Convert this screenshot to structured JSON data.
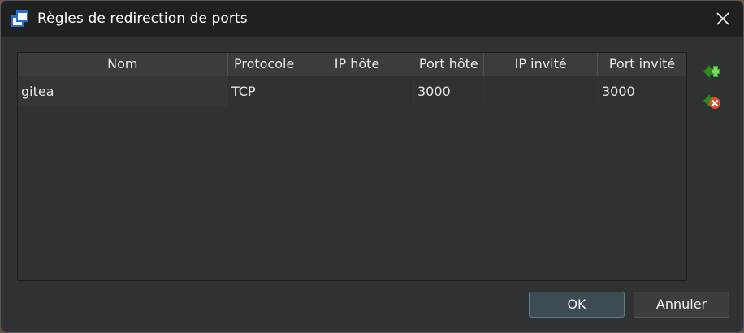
{
  "window": {
    "title": "Règles de redirection de ports",
    "icon": "app-window-icon",
    "close_icon": "close-icon"
  },
  "table": {
    "columns": [
      "Nom",
      "Protocole",
      "IP hôte",
      "Port hôte",
      "IP invité",
      "Port invité"
    ],
    "rows": [
      [
        "gitea",
        "TCP",
        "",
        "3000",
        "",
        "3000"
      ]
    ]
  },
  "side_actions": {
    "add_icon": "add-rule-icon",
    "remove_icon": "remove-rule-icon"
  },
  "buttons": {
    "ok": "OK",
    "cancel": "Annuler"
  },
  "colors": {
    "titlebar": "#202020",
    "body": "#2f3133",
    "add_green": "#3fae29",
    "remove_red": "#e04b2b"
  }
}
